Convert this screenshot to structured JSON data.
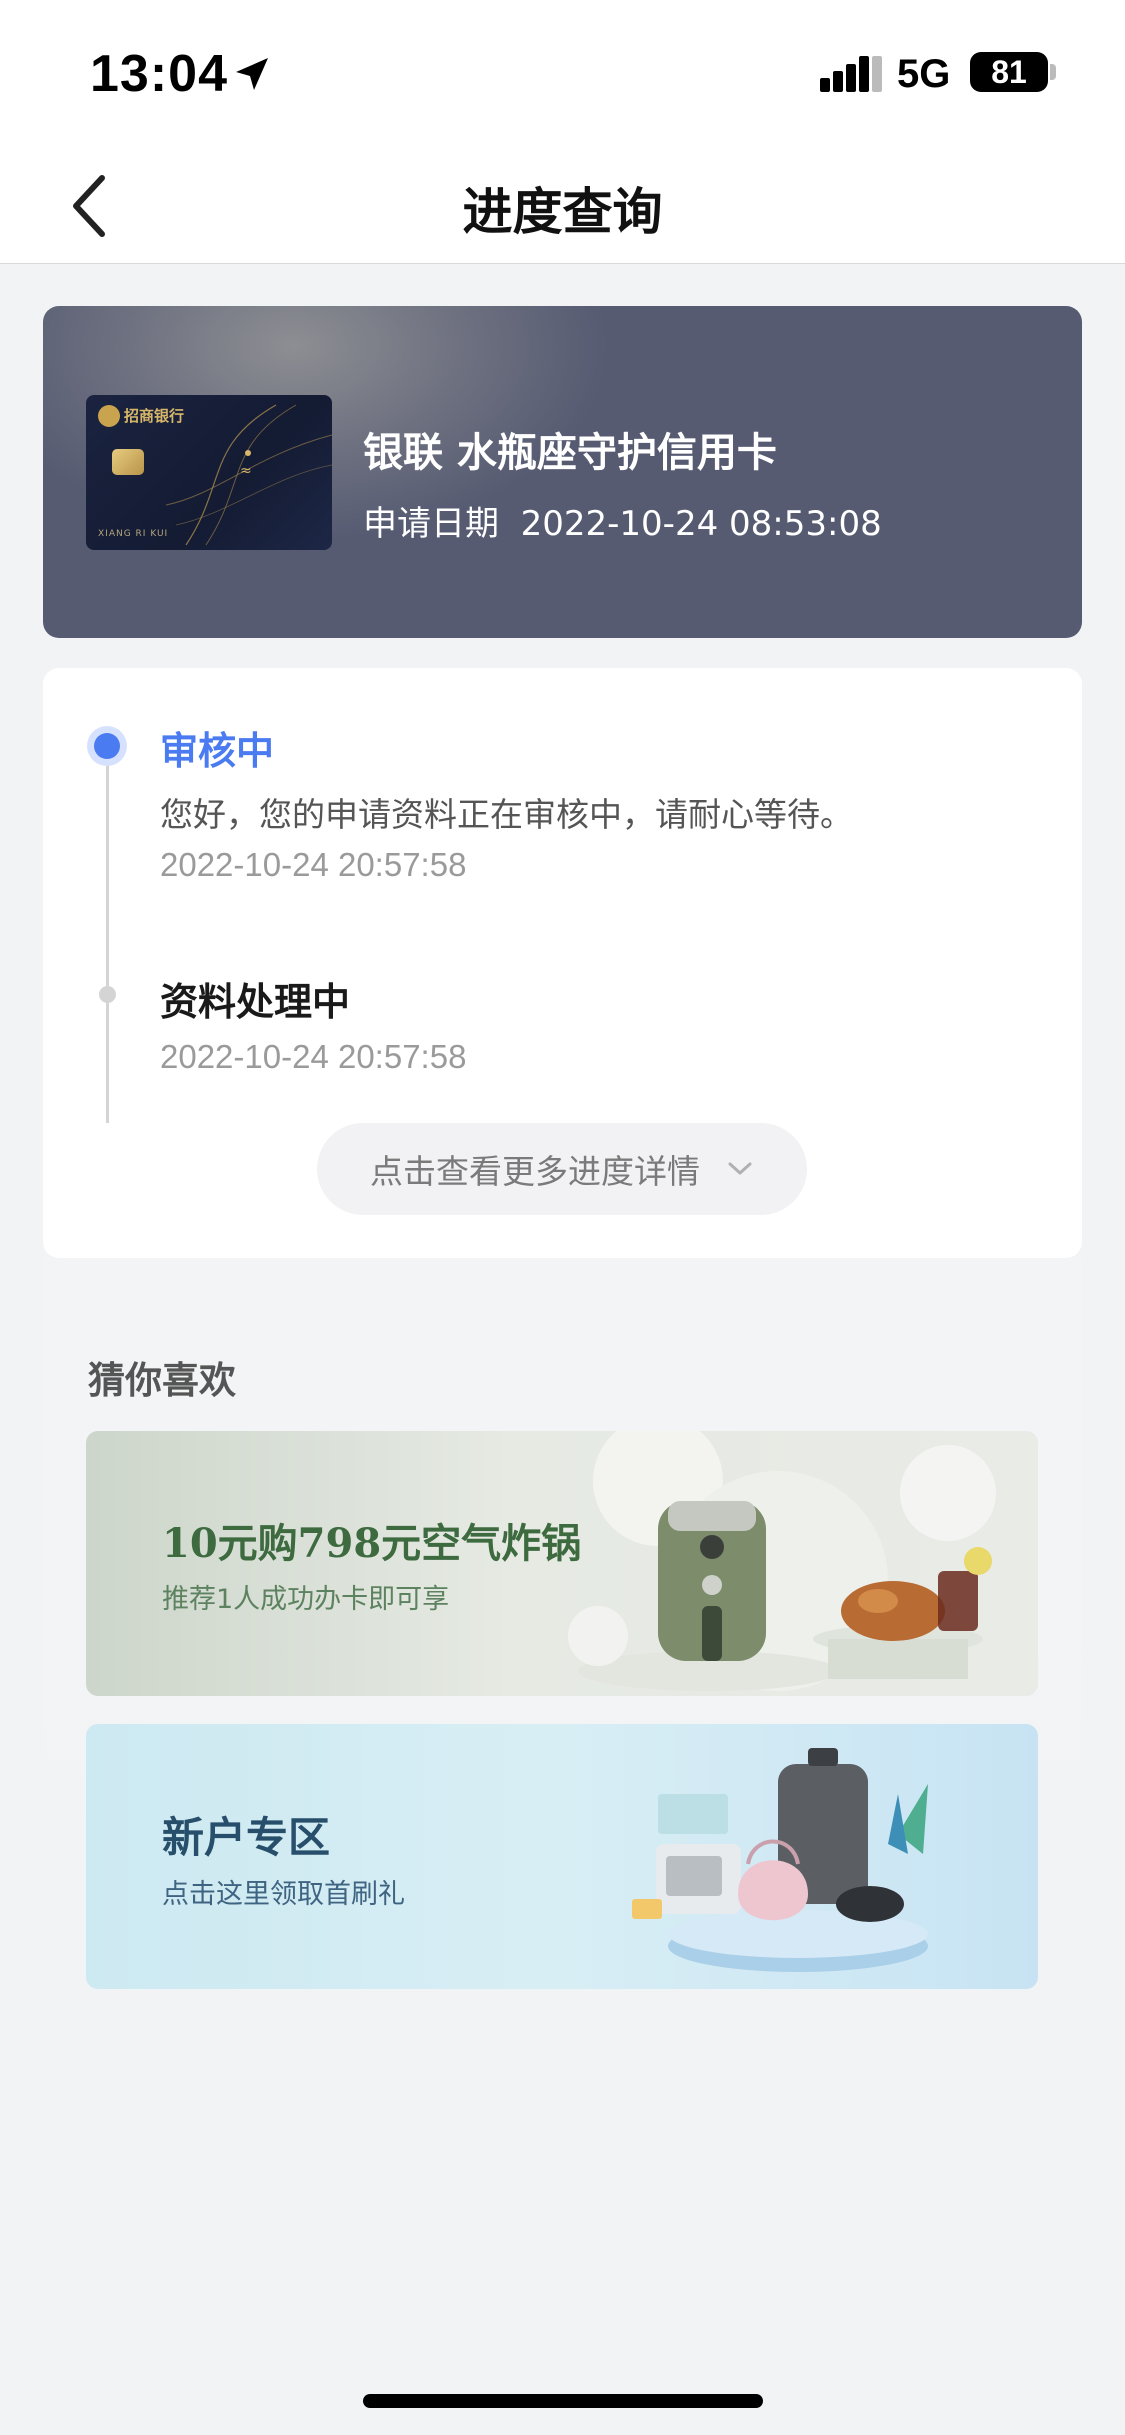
{
  "status_bar": {
    "time": "13:04",
    "network": "5G",
    "battery": "81"
  },
  "nav": {
    "title": "进度查询"
  },
  "card": {
    "bank_name": "招商银行",
    "holder_text": "XIANG RI KUI",
    "name": "银联 水瓶座守护信用卡",
    "date_label": "申请日期",
    "date_value": "2022-10-24 08:53:08"
  },
  "progress": {
    "steps": [
      {
        "title": "审核中",
        "description": "您好，您的申请资料正在审核中，请耐心等待。",
        "time": "2022-10-24 20:57:58",
        "active": true
      },
      {
        "title": "资料处理中",
        "time": "2022-10-24 20:57:58",
        "active": false
      }
    ],
    "more_label": "点击查看更多进度详情"
  },
  "recommend": {
    "title": "猜你喜欢",
    "banners": [
      {
        "title": "10元购798元空气炸锅",
        "subtitle": "推荐1人成功办卡即可享"
      },
      {
        "title": "新户专区",
        "subtitle": "点击这里领取首刷礼"
      }
    ]
  },
  "colors": {
    "accent": "#4b7bf0",
    "card_header_bg": "#565b72",
    "page_bg": "#f2f3f5"
  }
}
